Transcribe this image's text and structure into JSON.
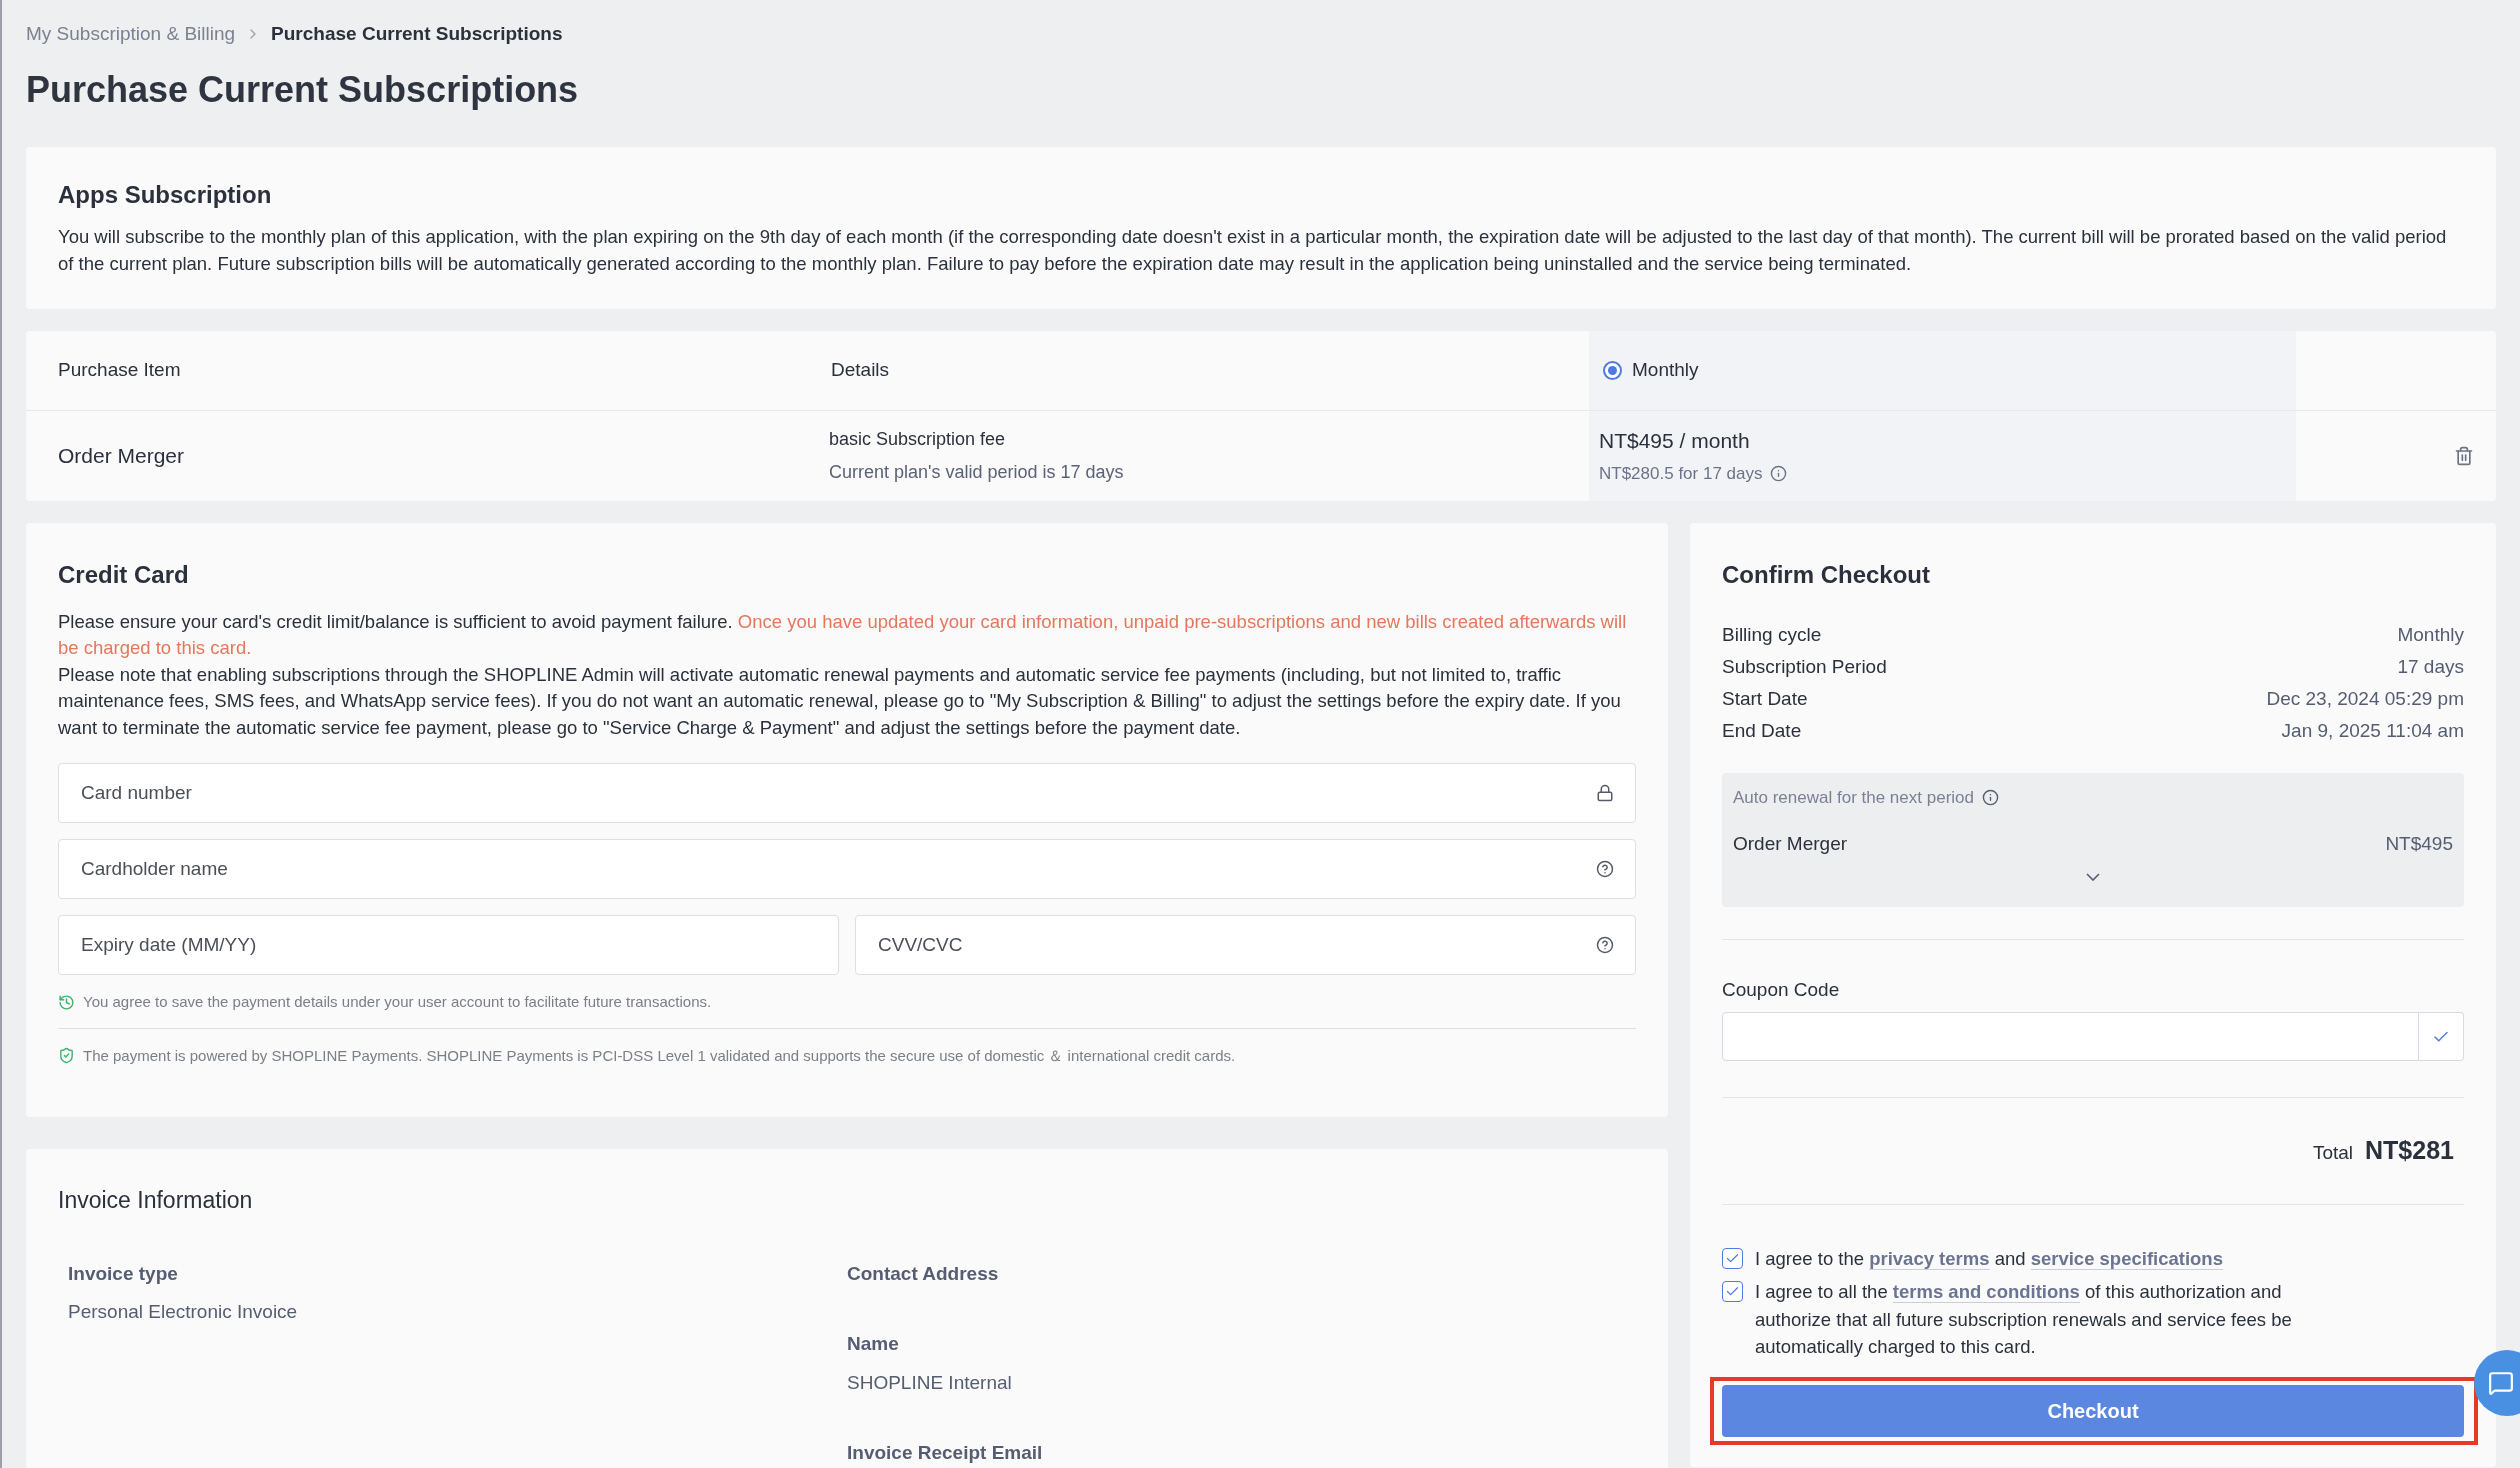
{
  "breadcrumb": [
    {
      "label": "My Subscription & Billing",
      "current": false
    },
    {
      "label": "Purchase Current Subscriptions",
      "current": true
    }
  ],
  "page_title": "Purchase Current Subscriptions",
  "apps_subscription": {
    "title": "Apps Subscription",
    "description": "You will subscribe to the monthly plan of this application, with the plan expiring on the 9th day of each month (if the corresponding date doesn't exist in a particular month, the expiration date will be adjusted to the last day of that month). The current bill will be prorated based on the valid period of the current plan. Future subscription bills will be automatically generated according to the monthly plan. Failure to pay before the expiration date may result in the application being uninstalled and the service being terminated."
  },
  "table": {
    "columns": [
      "Purchase Item",
      "Details"
    ],
    "plans": [
      {
        "label": "Monthly",
        "selected": true
      }
    ],
    "rows": [
      {
        "item": "Order Merger",
        "detail": "basic Subscription fee",
        "detail_note": "Current plan's valid period is 17 days",
        "price": "NT$495 / month",
        "prorated": "NT$280.5 for 17 days"
      }
    ]
  },
  "credit_card": {
    "title": "Credit Card",
    "notice": "Please ensure your card's credit limit/balance is sufficient to avoid payment failure. ",
    "warning": "Once you have updated your card information, unpaid pre-subscriptions and new bills created afterwards will be charged to this card.",
    "note": "Please note that enabling subscriptions through the SHOPLINE Admin will activate automatic renewal payments and automatic service fee payments (including, but not limited to, traffic maintenance fees, SMS fees, and WhatsApp service fees). If you do not want an automatic renewal, please go to \"My Subscription & Billing\" to adjust the settings before the expiry date. If you want to terminate the automatic service fee payment, please go to \"Service Charge & Payment\" and adjust the settings before the payment date.",
    "fields": [
      {
        "placeholder": "Card number"
      },
      {
        "placeholder": "Cardholder name"
      },
      {
        "placeholder": "Expiry date (MM/YY)"
      },
      {
        "placeholder": "CVV/CVC"
      }
    ],
    "save_note": "You agree to save the payment details under your user account to facilitate future transactions.",
    "security_note": "The payment is powered by SHOPLINE Payments. SHOPLINE Payments is PCI-DSS Level 1 validated and supports the secure use of domestic ＆ international credit cards."
  },
  "invoice": {
    "title": "Invoice Information",
    "left": [
      {
        "label": "Invoice type",
        "value": "Personal Electronic Invoice"
      }
    ],
    "right": [
      {
        "label": "Contact Address"
      },
      {
        "label": "Name",
        "value": "SHOPLINE Internal"
      },
      {
        "label": "Invoice Receipt Email"
      }
    ]
  },
  "checkout": {
    "title": "Confirm Checkout",
    "summary": [
      {
        "label": "Billing cycle",
        "value": "Monthly"
      },
      {
        "label": "Subscription Period",
        "value": "17 days"
      },
      {
        "label": "Start Date",
        "value": "Dec 23, 2024 05:29 pm"
      },
      {
        "label": "End Date",
        "value": "Jan 9, 2025 11:04 am"
      }
    ],
    "renewal": {
      "title": "Auto renewal for the next period",
      "expanded": false,
      "items": [
        {
          "name": "Order Merger",
          "price": "NT$495"
        }
      ]
    },
    "coupon_label": "Coupon Code",
    "total_label": "Total",
    "total": "NT$281",
    "agreements": [
      {
        "checked": true,
        "parts": [
          {
            "kind": "text",
            "text": "I agree to the "
          },
          {
            "kind": "link",
            "text": "privacy terms"
          },
          {
            "kind": "text",
            "text": " and "
          },
          {
            "kind": "link",
            "text": "service specifications"
          }
        ]
      },
      {
        "checked": true,
        "parts": [
          {
            "kind": "text",
            "text": "I agree to all the "
          },
          {
            "kind": "link",
            "text": "terms and conditions"
          },
          {
            "kind": "text",
            "text": " of this authorization and authorize that all future subscription renewals and service fees be automatically charged to this card."
          }
        ]
      }
    ],
    "button": "Checkout",
    "highlighted": true
  }
}
